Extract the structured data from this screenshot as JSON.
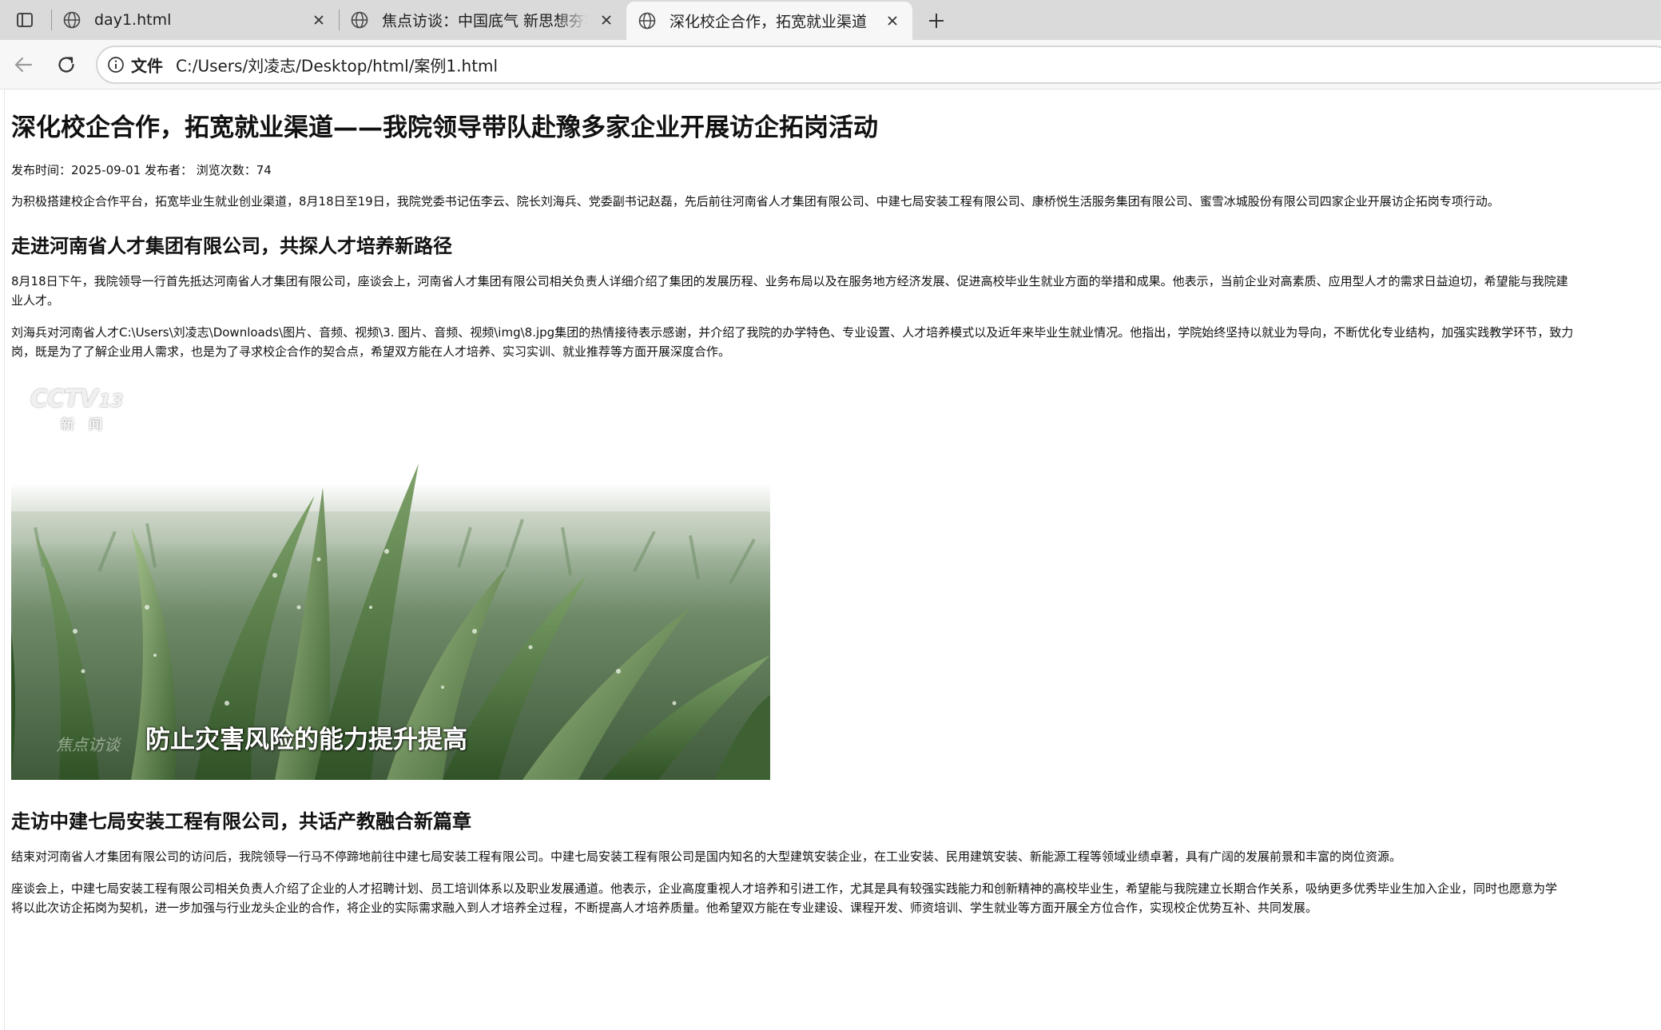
{
  "browser": {
    "tabs": [
      {
        "title": "day1.html",
        "active": false
      },
      {
        "title": "焦点访谈：中国底气 新思想夯实大国粮仓",
        "active": false
      },
      {
        "title": "深化校企合作，拓宽就业渠道",
        "active": true
      }
    ],
    "address": {
      "scheme": "文件",
      "url": "C:/Users/刘凌志/Desktop/html/案例1.html"
    },
    "icons": {
      "tab_actions": "tab-actions-icon",
      "globe": "globe-icon",
      "close": "close-icon",
      "new_tab": "plus-icon",
      "back": "back-arrow-icon",
      "reload": "reload-icon",
      "info": "info-icon"
    }
  },
  "article": {
    "title": "深化校企合作，拓宽就业渠道——我院领导带队赴豫多家企业开展访企拓岗活动",
    "meta": "发布时间：2025-09-01 发布者： 浏览次数：74",
    "intro": "为积极搭建校企合作平台，拓宽毕业生就业创业渠道，8月18日至19日，我院党委书记伍李云、院长刘海兵、党委副书记赵磊，先后前往河南省人才集团有限公司、中建七局安装工程有限公司、康桥悦生活服务集团有限公司、蜜雪冰城股份有限公司四家企业开展访企拓岗专项行动。",
    "section1": {
      "heading": "走进河南省人才集团有限公司，共探人才培养新路径",
      "p1": "8月18日下午，我院领导一行首先抵达河南省人才集团有限公司，座谈会上，河南省人才集团有限公司相关负责人详细介绍了集团的发展历程、业务布局以及在服务地方经济发展、促进高校毕业生就业方面的举措和成果。他表示，当前企业对高素质、应用型人才的需求日益迫切，希望能与我院建",
      "p1_wrap": "业人才。",
      "p2": "刘海兵对河南省人才C:\\Users\\刘凌志\\Downloads\\图片、音频、视频\\3. 图片、音频、视频\\img\\8.jpg集团的热情接待表示感谢，并介绍了我院的办学特色、专业设置、人才培养模式以及近年来毕业生就业情况。他指出，学院始终坚持以就业为导向，不断优化专业结构，加强实践教学环节，致力",
      "p2_wrap": "岗，既是为了了解企业用人需求，也是为了寻求校企合作的契合点，希望双方能在人才培养、实习实训、就业推荐等方面开展深度合作。"
    },
    "image": {
      "caption": "防止灾害风险的能力提升提高",
      "watermark_brand": "CCTV",
      "watermark_channel": "13",
      "watermark_sub": "新闻",
      "watermark_bottom": "焦点访谈"
    },
    "section2": {
      "heading": "走访中建七局安装工程有限公司，共话产教融合新篇章",
      "p1": "结束对河南省人才集团有限公司的访问后，我院领导一行马不停蹄地前往中建七局安装工程有限公司。中建七局安装工程有限公司是国内知名的大型建筑安装企业，在工业安装、民用建筑安装、新能源工程等领域业绩卓著，具有广阔的发展前景和丰富的岗位资源。",
      "p2": "座谈会上，中建七局安装工程有限公司相关负责人介绍了企业的人才招聘计划、员工培训体系以及职业发展通道。他表示，企业高度重视人才培养和引进工作，尤其是具有较强实践能力和创新精神的高校毕业生，希望能与我院建立长期合作关系，吸纳更多优秀毕业生加入企业，同时也愿意为学",
      "p2_wrap": "将以此次访企拓岗为契机，进一步加强与行业龙头企业的合作，将企业的实际需求融入到人才培养全过程，不断提高人才培养质量。他希望双方能在专业建设、课程开发、师资培训、学生就业等方面开展全方位合作，实现校企优势互补、共同发展。"
    }
  }
}
